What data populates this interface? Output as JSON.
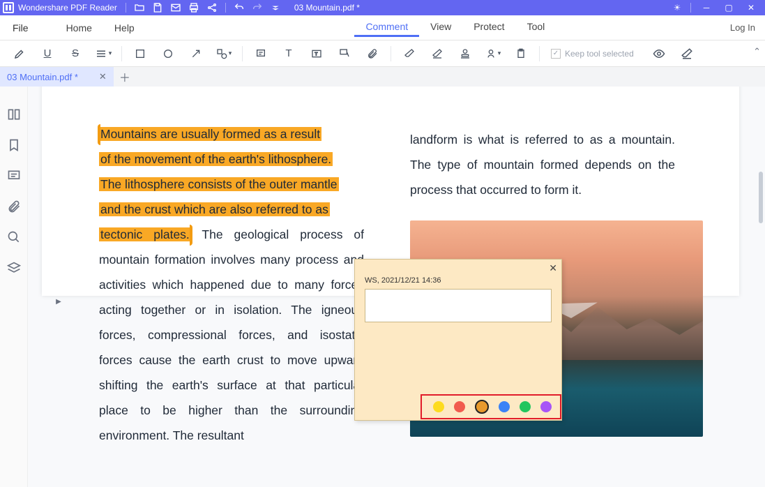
{
  "app": {
    "title": "Wondershare PDF Reader",
    "filename": "03 Mountain.pdf *"
  },
  "menu": {
    "file": "File",
    "items": [
      "Home",
      "Help",
      "Comment",
      "View",
      "Protect",
      "Tool"
    ],
    "active": "Comment",
    "login": "Log In"
  },
  "toolbar": {
    "keep_label": "Keep tool selected"
  },
  "tab": {
    "label": "03 Mountain.pdf *"
  },
  "doc": {
    "colL_parts": {
      "h1": "Mountains are usually formed as a result",
      "h2": "of the movement of the earth's lithosphere.",
      "h3": "The lithosphere consists of the outer mantle",
      "h4": "and the crust which are also referred to as",
      "h5": "tectonic plates.",
      "rest": " The geological process of mountain formation involves many process and activities which happened due to many forces acting together or in isolation. The igneous forces, compressional forces, and isostatic forces cause the earth crust to move upward shifting the earth's surface at that particular place to be higher than the surrounding environment. The resultant"
    },
    "colR": "landform is what is referred to as a mountain. The type of mountain formed depends on the process that occurred to form it."
  },
  "popup": {
    "meta": "WS,  2021/12/21 14:36",
    "colors": [
      "#fddb1f",
      "#f15b4e",
      "#e89a2c",
      "#3b82f6",
      "#22c55e",
      "#a855f7"
    ],
    "selected": 2
  }
}
